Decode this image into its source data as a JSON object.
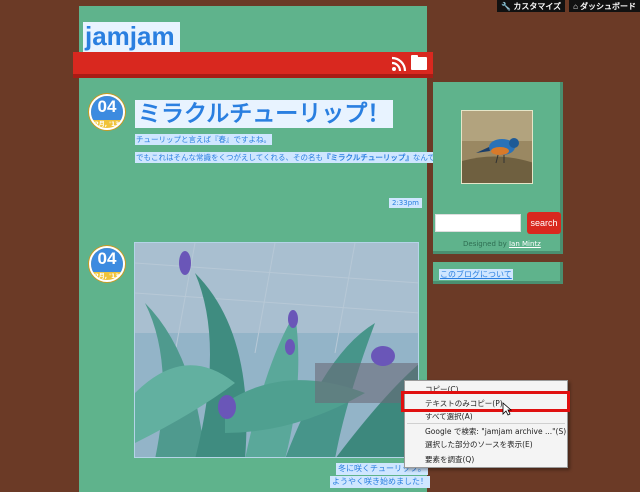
{
  "adminbar": {
    "customize": "カスタマイズ",
    "dashboard": "ダッシュボード"
  },
  "site": {
    "title": "jamjam"
  },
  "post1": {
    "badge_day": "04",
    "badge_month": "2月, '13",
    "title": "ミラクルチューリップ！",
    "line1": "チューリップと言えば『春』ですよね。",
    "line2_pre": "でもこれはそんな常識をくつがえしてくれる、その名も",
    "line2_bold": "『ミラクルチューリップ』",
    "line2_post": "なんです。",
    "time": "2:33pm"
  },
  "post2": {
    "badge_day": "04",
    "badge_month": "2月, '13",
    "caption1": "冬に咲くチューリップ。",
    "caption2": "ようやく咲き始めました！"
  },
  "sidebar": {
    "search_button": "search",
    "designed_by": "Designed by",
    "designer": "Ian Mintz",
    "about_link": "このブログについて"
  },
  "context_menu": {
    "items": [
      "コピー(C)",
      "テキストのみコピー(P)",
      "すべて選択(A)",
      "Google で検索: \"jamjam archive ...\"(S)",
      "選択した部分のソースを表示(E)",
      "要素を調査(Q)"
    ]
  },
  "colors": {
    "accent_red": "#d9281f",
    "highlight_blue": "#2a7fe0",
    "page_green": "#5fb38c"
  }
}
